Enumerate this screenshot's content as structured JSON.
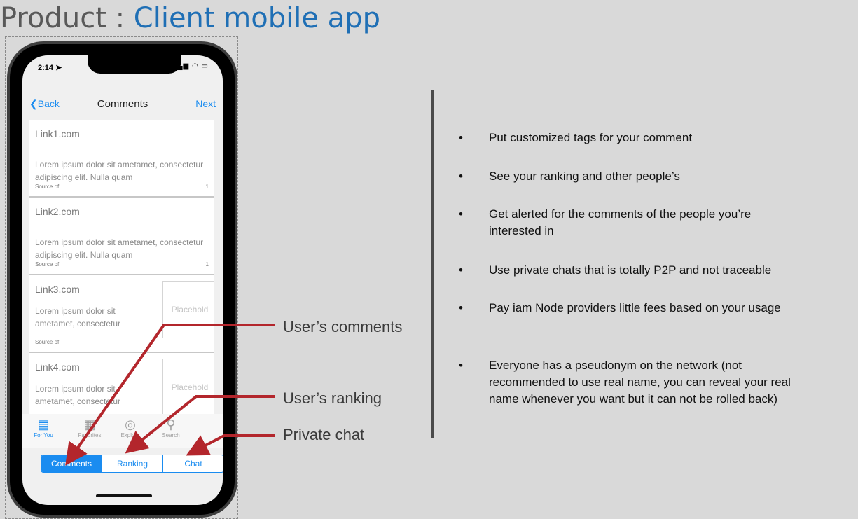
{
  "slide": {
    "title_prefix": "Product : ",
    "title_accent": "Client mobile app"
  },
  "phone": {
    "status_time": "2:14",
    "nav": {
      "back_label": "Back",
      "title": "Comments",
      "next_label": "Next"
    },
    "items": [
      {
        "link": "Link1.com",
        "body": "Lorem ipsum dolor sit ametamet, consectetur adipiscing elit. Nulla quam",
        "source": "Source of",
        "count": "1"
      },
      {
        "link": "Link2.com",
        "body": "Lorem ipsum dolor sit ametamet, consectetur adipiscing elit. Nulla quam",
        "source": "Source of",
        "count": "1"
      },
      {
        "link": "Link3.com",
        "body": "Lorem ipsum dolor sit ametamet, consectetur",
        "source": "Source of",
        "placeholder": "Placehold"
      },
      {
        "link": "Link4.com",
        "body": "Lorem ipsum dolor sit ametamet, consectetur",
        "placeholder": "Placehold"
      }
    ],
    "tabs": [
      {
        "label": "For You",
        "icon": "newspaper-icon"
      },
      {
        "label": "Favorites",
        "icon": "grid-icon"
      },
      {
        "label": "Explore",
        "icon": "compass-icon"
      },
      {
        "label": "Search",
        "icon": "search-icon"
      }
    ],
    "segments": [
      "Comments",
      "Ranking",
      "Chat"
    ],
    "accent_color": "#1a8cf0"
  },
  "annotations": {
    "comments": "User’s comments",
    "ranking": "User’s ranking",
    "chat": "Private chat",
    "arrow_color": "#b3262c"
  },
  "bullets": [
    "Put customized tags for your comment",
    "See your ranking and other people’s",
    "Get alerted for the comments of the people you’re interested in",
    "Use private chats that is totally P2P and not traceable",
    "Pay iam Node providers little fees based on your usage",
    "Everyone has a pseudonym on the network (not recommended to use real name, you can reveal your real name whenever you want but it can not be rolled back)"
  ]
}
